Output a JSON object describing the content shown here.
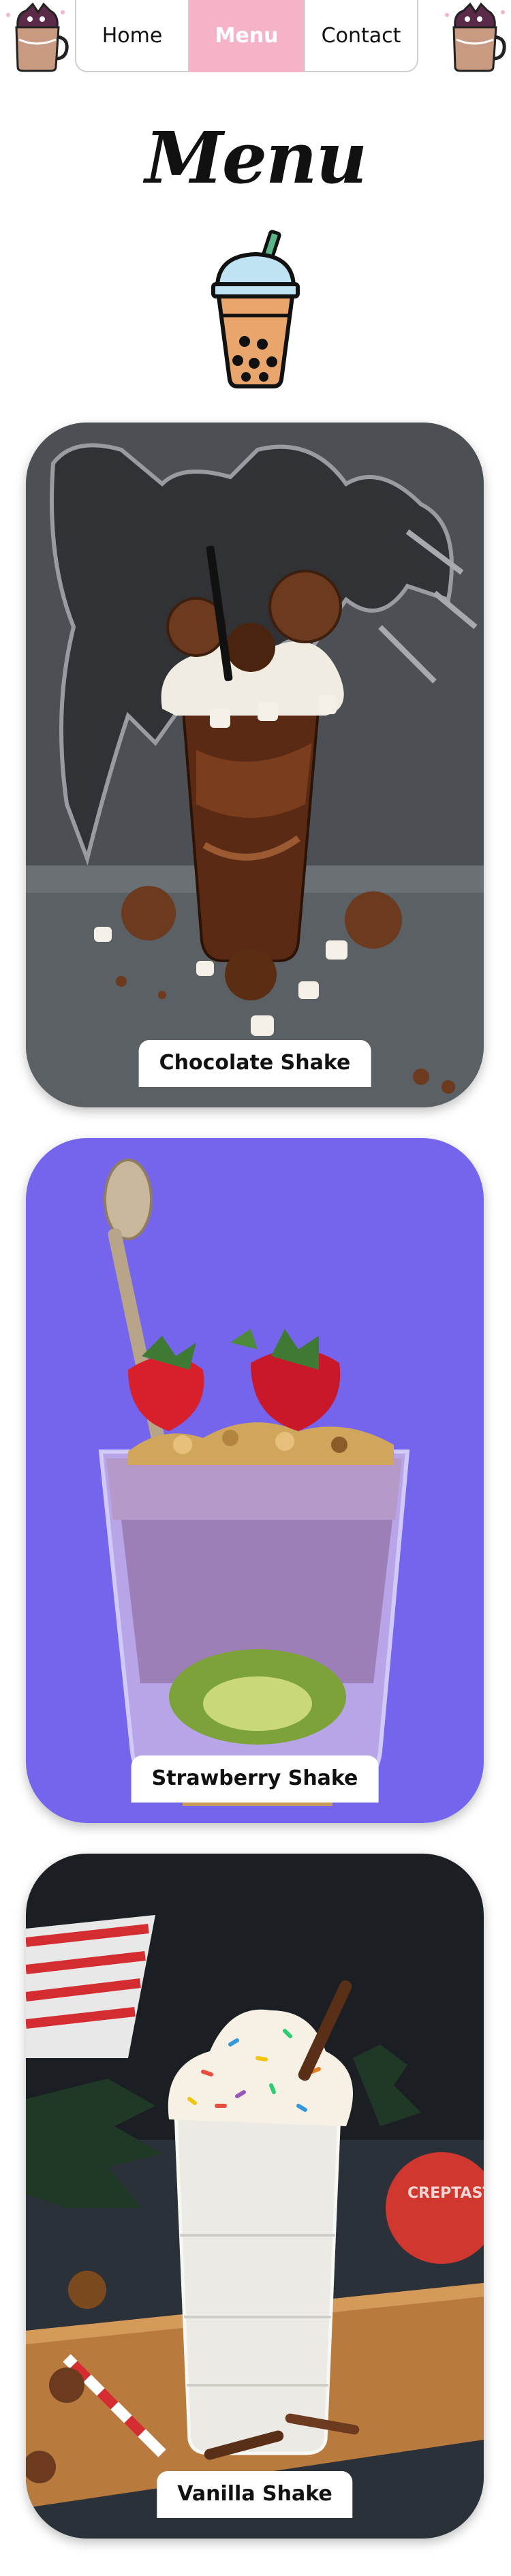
{
  "nav": {
    "tabs": [
      {
        "label": "Home",
        "active": false
      },
      {
        "label": "Menu",
        "active": true
      },
      {
        "label": "Contact",
        "active": false
      }
    ],
    "logo_icon": "bubble-tea-mug-icon",
    "active_color": "#f6b3c8"
  },
  "header": {
    "title": "Menu",
    "icon": "bubble-tea-cup-icon"
  },
  "menu": {
    "items": [
      {
        "name": "Chocolate Shake",
        "image": "chocolate-shake-photo"
      },
      {
        "name": "Strawberry Shake",
        "image": "strawberry-shake-photo"
      },
      {
        "name": "Vanilla Shake",
        "image": "vanilla-shake-photo"
      }
    ]
  }
}
